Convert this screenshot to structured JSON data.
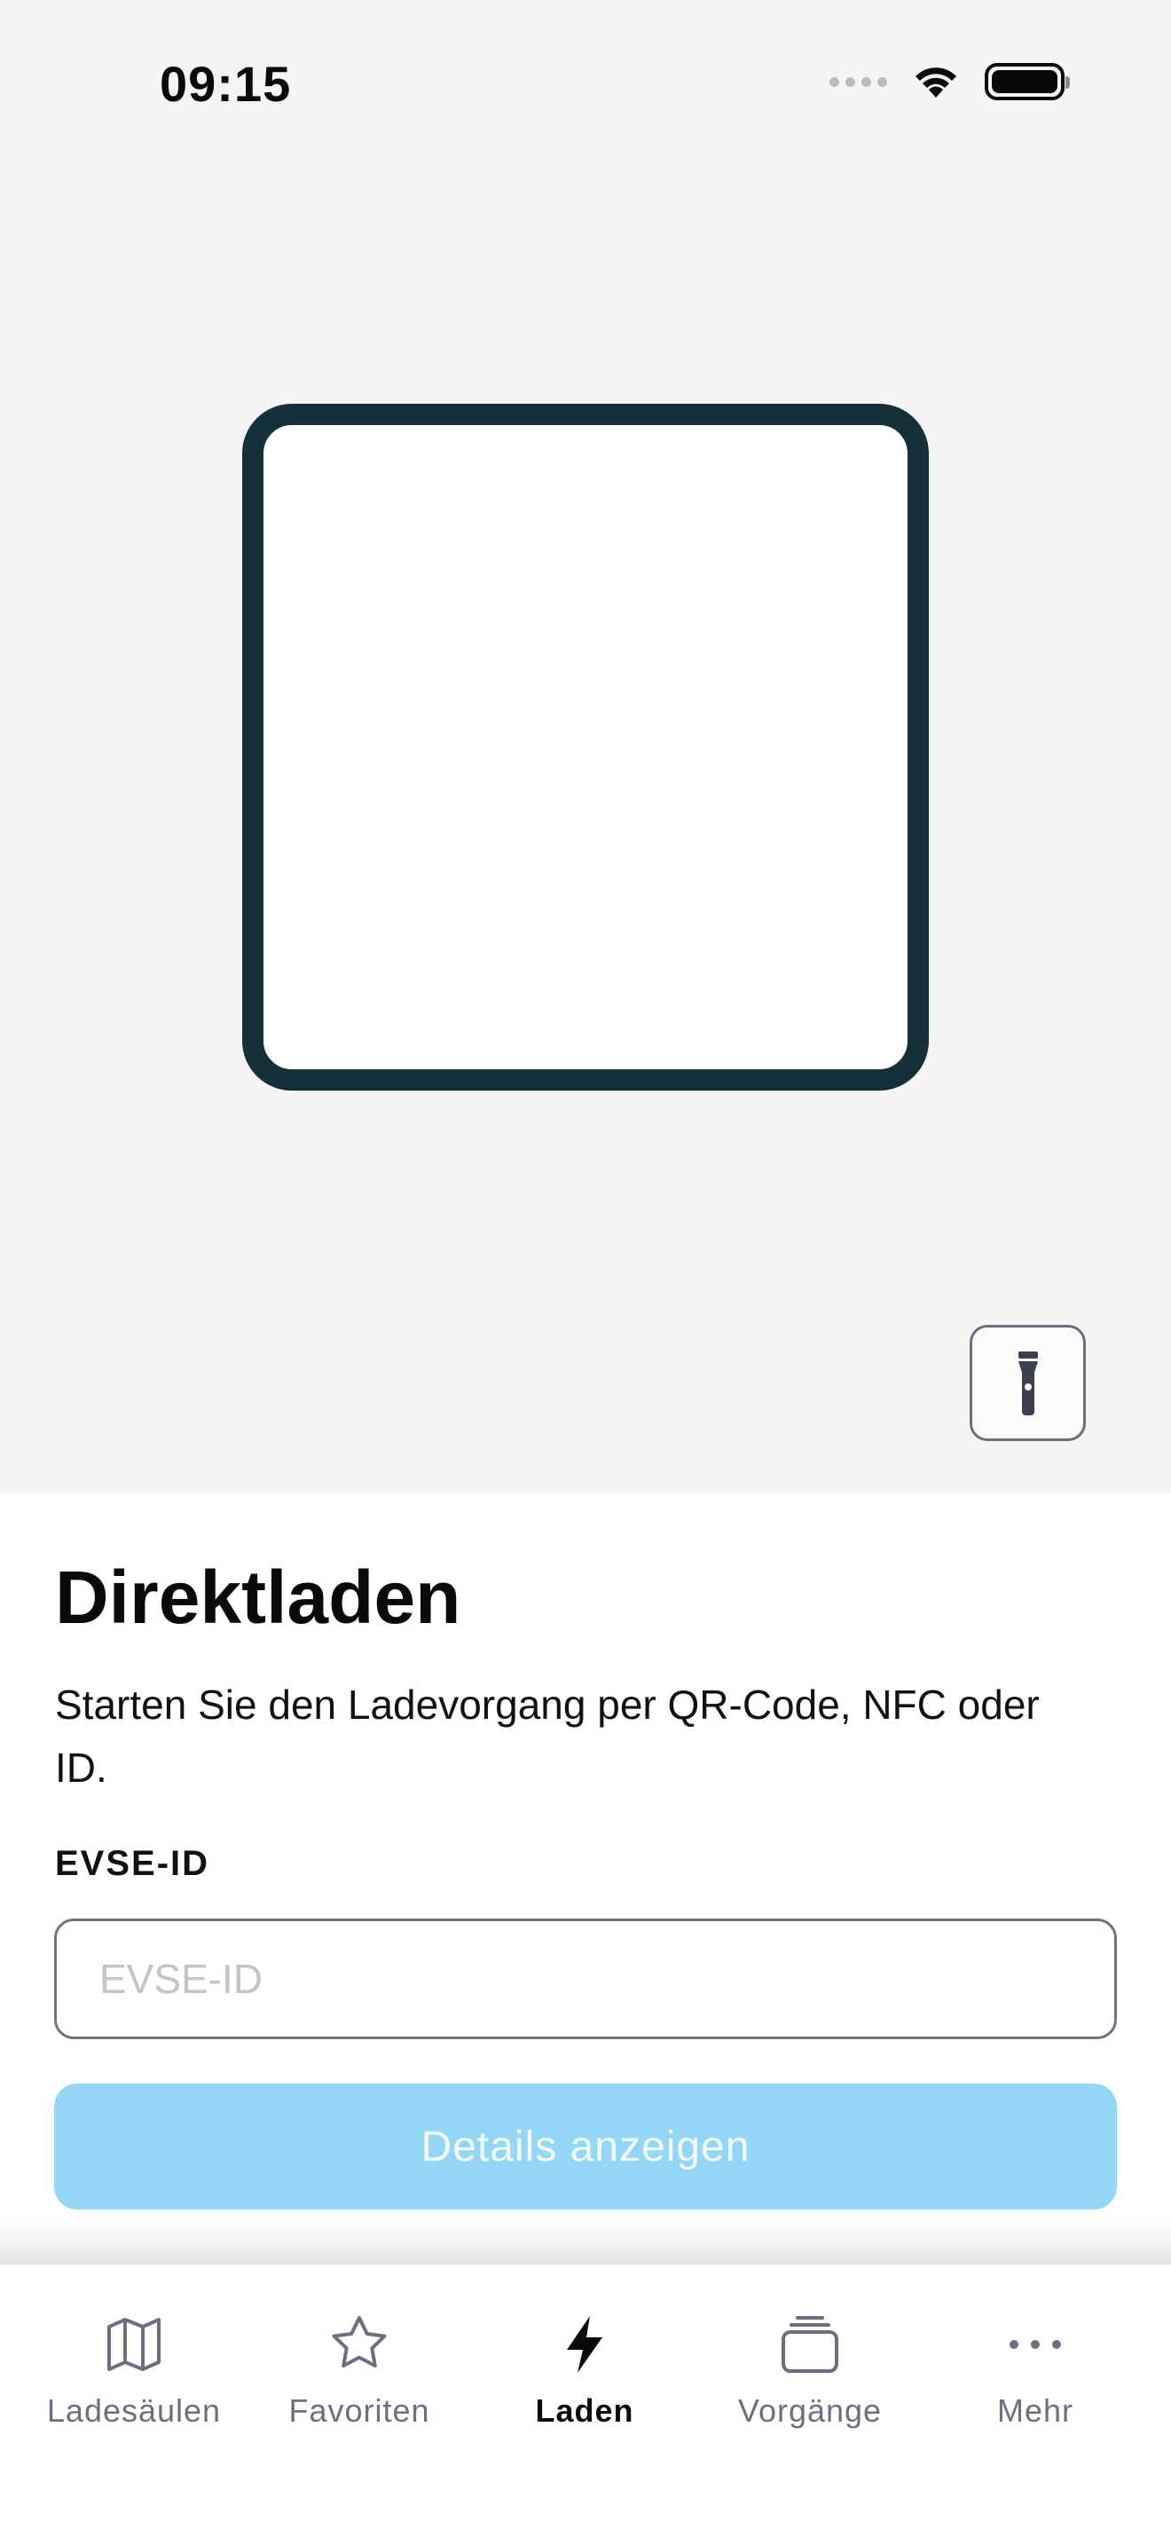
{
  "status_bar": {
    "time": "09:15"
  },
  "scanner": {
    "torch_icon": "flashlight-icon"
  },
  "content": {
    "title": "Direktladen",
    "subtitle": "Starten Sie den Ladevorgang per QR-Code, NFC oder ID.",
    "field_label": "EVSE-ID",
    "field_value": "",
    "field_placeholder": "EVSE-ID",
    "submit_label": "Details anzeigen"
  },
  "tabs": [
    {
      "label": "Ladesäulen",
      "icon": "map-icon",
      "active": false
    },
    {
      "label": "Favoriten",
      "icon": "star-icon",
      "active": false
    },
    {
      "label": "Laden",
      "icon": "lightning-icon",
      "active": true
    },
    {
      "label": "Vorgänge",
      "icon": "stack-icon",
      "active": false
    },
    {
      "label": "Mehr",
      "icon": "more-icon",
      "active": false
    }
  ],
  "colors": {
    "accent_disabled": "#93d6f5",
    "frame": "#16303a",
    "tab_inactive": "#6c6f7f",
    "tab_active": "#0a0a0a",
    "scanner_bg": "#f4f4f4"
  }
}
